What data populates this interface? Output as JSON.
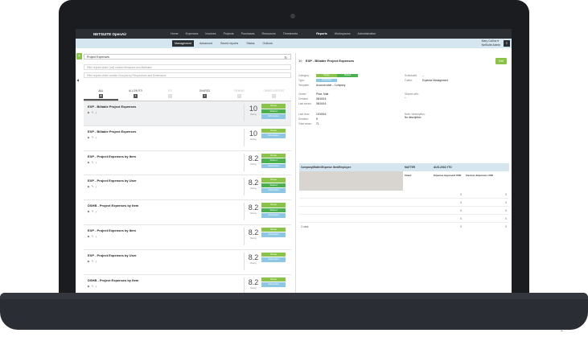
{
  "app": {
    "logo": "NETSUITE OpenAir"
  },
  "topnav": [
    "Home",
    "Expenses",
    "Invoices",
    "Projects",
    "Purchases",
    "Resources",
    "Timesheets",
    "Reports",
    "Workspaces",
    "Administration"
  ],
  "topnav_active": "Reports",
  "subnav": [
    "Management",
    "Advanced",
    "Saved reports",
    "Status",
    "Outlook"
  ],
  "subnav_active": "Management",
  "user": {
    "name": "Mary Collins ▾",
    "role": "NetSuite Admin"
  },
  "left": {
    "title": "Project Expenses",
    "filter1": "Filter reports which (not) contain Measures and Attributes",
    "filter2": "Filter reports which contain Grouped by Perspectives and Dimensions",
    "tabs": [
      {
        "label": "ALL",
        "count": "8"
      },
      {
        "label": "ALLOW RTI",
        "count": "3"
      },
      {
        "label": "RTI",
        "count": "0"
      },
      {
        "label": "SHARED",
        "count": "3"
      },
      {
        "label": "REMIND",
        "count": "0"
      },
      {
        "label": "OWNED REPORT",
        "count": "0"
      }
    ],
    "rating_label": "Rating",
    "items": [
      {
        "name": "EXP - Billable Project Expenses",
        "rating": "10",
        "badges": [
          "Scope",
          "Shared",
          "Scheduled"
        ]
      },
      {
        "name": "EXP - Billable Project Expenses",
        "rating": "10",
        "badges": [
          "Scope",
          "Scheduled"
        ]
      },
      {
        "name": "EXP - Project Expenses by Item",
        "rating": "8.2",
        "badges": [
          "Scope",
          "Shared",
          "Scheduled"
        ]
      },
      {
        "name": "EXP - Project Expenses by User",
        "rating": "8.2",
        "badges": [
          "Scope",
          "Shared",
          "Scheduled"
        ]
      },
      {
        "name": "DSHB - Project Expenses by Item",
        "rating": "8.2",
        "badges": [
          "Scope",
          "Shared",
          "Scheduled"
        ]
      },
      {
        "name": "EXP - Project Expenses by Item",
        "rating": "8.2",
        "badges": [
          "Scope",
          "Scheduled"
        ]
      },
      {
        "name": "EXP - Project Expenses by User",
        "rating": "8.2",
        "badges": [
          "Scope",
          "Scheduled"
        ]
      },
      {
        "name": "DSHB - Project Expenses by Item",
        "rating": "8.2",
        "badges": [
          "Scope",
          "Scheduled"
        ]
      }
    ]
  },
  "right": {
    "header": "EXP - Billable Project Expenses",
    "num": "10",
    "edit": "Edit",
    "category_label": "Category:",
    "type_label": "Type:",
    "template_label": "Template:",
    "template": "Account-wide – Company",
    "owner_label": "Owner:",
    "owner": "Price, Matt",
    "created_label": "Created:",
    "created": "08/16/16",
    "last_saved_label": "Last saved:",
    "last_saved": "08/16/16",
    "last_view_label": "Last view:",
    "last_view": "10/18/16",
    "duration_label": "Duration:",
    "duration": "8",
    "total_views_label": "Total views:",
    "total_views": "71",
    "scheduled_label": "Scheduled:",
    "scheduled": "–",
    "folder_label": "Folder:",
    "folder": "Expense Management",
    "shared_label": "Shared with:",
    "shared": "–",
    "note_label": "Note / description:",
    "note": "No description",
    "table": {
      "col1": "Company/Matter/Expense Item/Employee",
      "col2": "MATTER",
      "col3": "AUG-2016-YTD",
      "sub1": "Client",
      "sub2": "Expense Approved USD",
      "sub3": "Invoices Expenses USD",
      "rows": [
        [
          "0",
          "0"
        ],
        [
          "0",
          "0"
        ],
        [
          "0",
          "0"
        ],
        [
          "0",
          "0"
        ]
      ],
      "footer": "2 rows",
      "footer_v1": "0",
      "footer_v2": "0"
    }
  }
}
